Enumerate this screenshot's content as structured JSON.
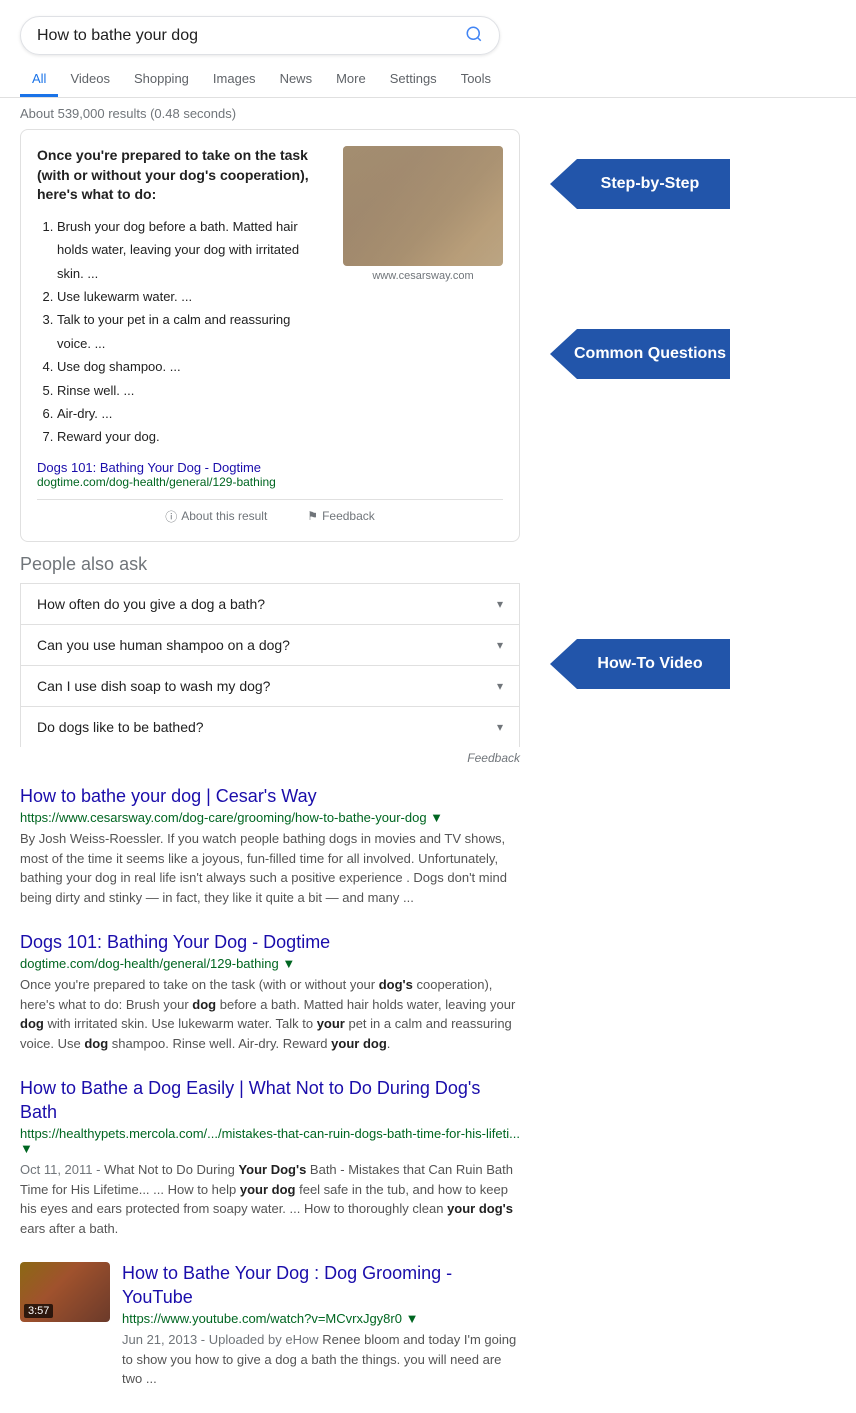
{
  "search": {
    "query": "How to bathe your dog",
    "placeholder": "How to bathe your dog",
    "results_count": "About 539,000 results (0.48 seconds)"
  },
  "nav": {
    "tabs": [
      {
        "label": "All",
        "active": true
      },
      {
        "label": "Videos",
        "active": false
      },
      {
        "label": "Shopping",
        "active": false
      },
      {
        "label": "Images",
        "active": false
      },
      {
        "label": "News",
        "active": false
      },
      {
        "label": "More",
        "active": false
      },
      {
        "label": "Settings",
        "active": false
      },
      {
        "label": "Tools",
        "active": false
      }
    ]
  },
  "featured_snippet": {
    "title": "Once you're prepared to take on the task (with or without your dog's cooperation), here's what to do:",
    "steps": [
      "Brush your dog before a bath. Matted hair holds water, leaving your dog with irritated skin. ...",
      "Use lukewarm water. ...",
      "Talk to your pet in a calm and reassuring voice. ...",
      "Use dog shampoo. ...",
      "Rinse well. ...",
      "Air-dry. ...",
      "Reward your dog."
    ],
    "source_title": "Dogs 101: Bathing Your Dog - Dogtime",
    "source_url": "dogtime.com/dog-health/general/129-bathing",
    "source_href": "https://dogtime.com/dog-health/general/129-bathing",
    "image_caption": "www.cesarsway.com",
    "footer_about": "About this result",
    "footer_feedback": "Feedback"
  },
  "people_also_ask": {
    "title": "People also ask",
    "questions": [
      "How often do you give a dog a bath?",
      "Can you use human shampoo on a dog?",
      "Can I use dish soap to wash my dog?",
      "Do dogs like to be bathed?"
    ],
    "feedback_label": "Feedback"
  },
  "results": [
    {
      "title": "How to bathe your dog | Cesar's Way",
      "url": "https://www.cesarsway.com/dog-care/grooming/how-to-bathe-your-dog",
      "display_url": "https://www.cesarsway.com/dog-care/grooming/how-to-bathe-your-dog ▼",
      "snippet": "By Josh Weiss-Roessler. If you watch people bathing dogs in movies and TV shows, most of the time it seems like a joyous, fun-filled time for all involved. Unfortunately, bathing your dog in real life isn't always such a positive experience . Dogs don't mind being dirty and stinky — in fact, they like it quite a bit — and many ..."
    },
    {
      "title": "Dogs 101: Bathing Your Dog - Dogtime",
      "url": "https://dogtime.com/dog-health/general/129-bathing",
      "display_url": "dogtime.com/dog-health/general/129-bathing ▼",
      "snippet": "Once you're prepared to take on the task (with or without your dog's cooperation), here's what to do: Brush your dog before a bath. Matted hair holds water, leaving your dog with irritated skin. Use lukewarm water. Talk to your pet in a calm and reassuring voice. Use dog shampoo. Rinse well. Air-dry. Reward your dog."
    },
    {
      "title": "How to Bathe a Dog Easily | What Not to Do During Dog's Bath",
      "url": "https://healthypets.mercola.com/.../mistakes-that-can-ruin-dogs-bath-time-for-his-lifeti...",
      "display_url": "https://healthypets.mercola.com/.../mistakes-that-can-ruin-dogs-bath-time-for-his-lifeti... ▼",
      "date": "Oct 11, 2011 - ",
      "snippet": "What Not to Do During Your Dog's Bath - Mistakes that Can Ruin Bath Time for His Lifetime... ... How to help your dog feel safe in the tub, and how to keep his eyes and ears protected from soapy water. ... How to thoroughly clean your dog's ears after a bath."
    }
  ],
  "video_result": {
    "title": "How to Bathe Your Dog : Dog Grooming - YouTube",
    "url": "https://www.youtube.com/watch?v=MCvrxJgy8r0",
    "display_url": "https://www.youtube.com/watch?v=MCvrxJgy8r0 ▼",
    "duration": "3:57",
    "date": "Jun 21, 2013 - Uploaded by eHow",
    "snippet": "Renee bloom and today I'm going to show you how to give a dog a bath the things. you will need are two ..."
  },
  "arrow_labels": {
    "step_by_step": "Step-by-Step",
    "common_questions": "Common Questions",
    "how_to_video": "How-To Video"
  }
}
